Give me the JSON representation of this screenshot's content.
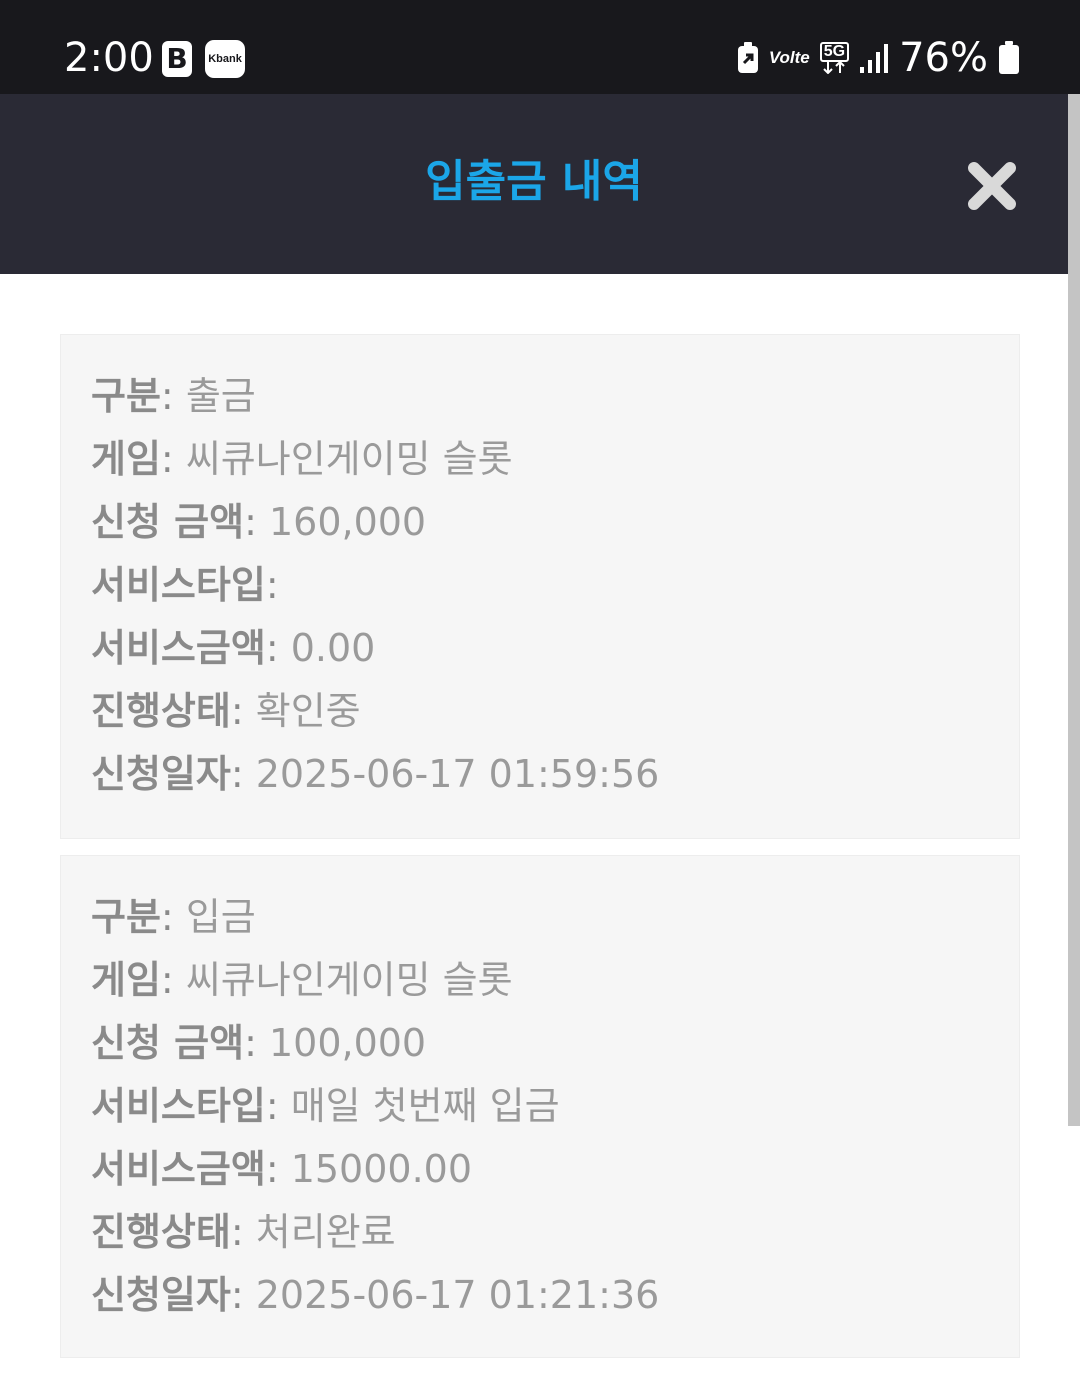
{
  "status_bar": {
    "time": "2:00",
    "app_icon_b": "B",
    "app_icon_kbank": "Kbank",
    "volte": "Volte",
    "network": "5G",
    "battery": "76%"
  },
  "header": {
    "title": "입출금 내역",
    "close_icon": "close-icon",
    "title_color": "#1ba6e8"
  },
  "cards": [
    {
      "fields": [
        {
          "label": "구분",
          "value": "출금"
        },
        {
          "label": "게임",
          "value": "씨큐나인게이밍 슬롯"
        },
        {
          "label": "신청 금액",
          "value": "160,000"
        },
        {
          "label": "서비스타입",
          "value": ""
        },
        {
          "label": "서비스금액",
          "value": "0.00"
        },
        {
          "label": "진행상태",
          "value": "확인중"
        },
        {
          "label": "신청일자",
          "value": "2025-06-17 01:59:56"
        }
      ]
    },
    {
      "fields": [
        {
          "label": "구분",
          "value": "입금"
        },
        {
          "label": "게임",
          "value": "씨큐나인게이밍 슬롯"
        },
        {
          "label": "신청 금액",
          "value": "100,000"
        },
        {
          "label": "서비스타입",
          "value": "매일 첫번째 입금"
        },
        {
          "label": "서비스금액",
          "value": "15000.00"
        },
        {
          "label": "진행상태",
          "value": "처리완료"
        },
        {
          "label": "신청일자",
          "value": "2025-06-17 01:21:36"
        }
      ]
    }
  ]
}
